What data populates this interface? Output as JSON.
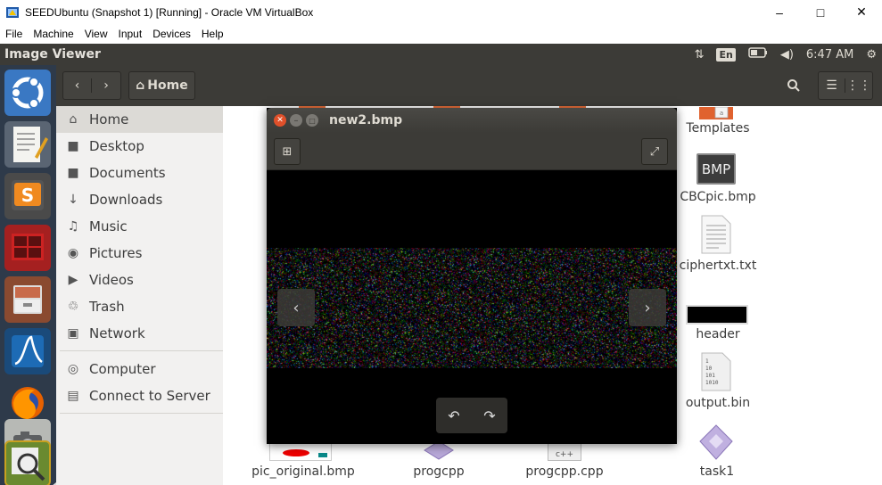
{
  "host": {
    "title": "SEEDUbuntu (Snapshot 1) [Running] - Oracle VM VirtualBox",
    "menu": [
      "File",
      "Machine",
      "View",
      "Input",
      "Devices",
      "Help"
    ]
  },
  "panel": {
    "app_title": "Image Viewer",
    "keyboard": "En",
    "time": "6:47 AM"
  },
  "nautilus": {
    "path_button": "Home",
    "sidebar": [
      {
        "label": "Home",
        "icon": "home-icon"
      },
      {
        "label": "Desktop",
        "icon": "folder-icon"
      },
      {
        "label": "Documents",
        "icon": "folder-icon"
      },
      {
        "label": "Downloads",
        "icon": "download-icon"
      },
      {
        "label": "Music",
        "icon": "music-icon"
      },
      {
        "label": "Pictures",
        "icon": "camera-icon"
      },
      {
        "label": "Videos",
        "icon": "video-icon"
      },
      {
        "label": "Trash",
        "icon": "trash-icon"
      },
      {
        "label": "Network",
        "icon": "network-icon"
      },
      {
        "label": "Computer",
        "icon": "computer-icon"
      },
      {
        "label": "Connect to Server",
        "icon": "server-icon"
      }
    ],
    "files": [
      {
        "name": "Templates"
      },
      {
        "name": "CBCpic.bmp",
        "badge": "BMP"
      },
      {
        "name": "ciphertxt.txt"
      },
      {
        "name": "header"
      },
      {
        "name": "output.bin",
        "content": "1\n10\n101\n1010"
      },
      {
        "name": "pic_original.bmp"
      },
      {
        "name": "progcpp"
      },
      {
        "name": "progcpp.cpp",
        "badge": "c++"
      },
      {
        "name": "task1"
      }
    ]
  },
  "viewer": {
    "title": "new2.bmp"
  }
}
